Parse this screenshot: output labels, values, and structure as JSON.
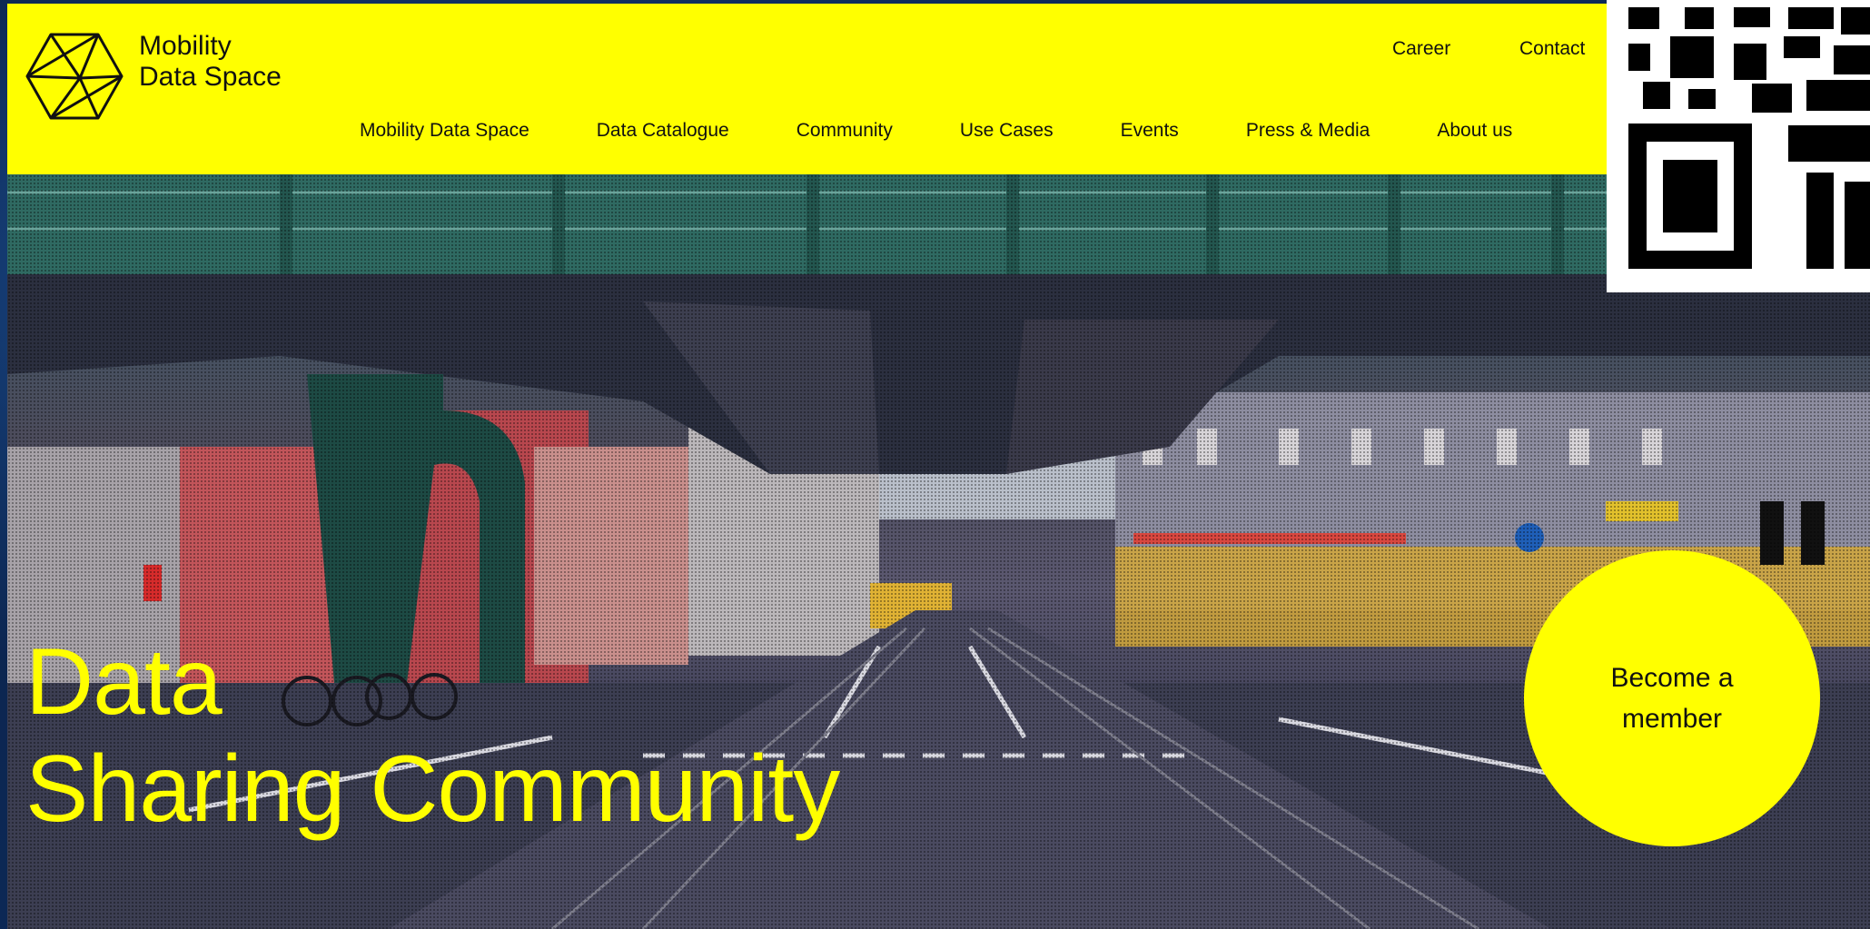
{
  "brand": {
    "line1": "Mobility",
    "line2": "Data Space",
    "logo_icon": "polyhedron-logo-icon",
    "color_yellow": "#ffff00"
  },
  "utility_nav": {
    "career": "Career",
    "contact": "Contact"
  },
  "main_nav": [
    {
      "label": "Mobility Data Space"
    },
    {
      "label": "Data Catalogue"
    },
    {
      "label": "Community"
    },
    {
      "label": "Use Cases"
    },
    {
      "label": "Events"
    },
    {
      "label": "Press & Media"
    },
    {
      "label": "About us"
    }
  ],
  "hero": {
    "title_line1": "Data",
    "title_line2": "Sharing Community",
    "cta_label": "Become a member",
    "image": "berlin-street-under-elevated-railway"
  },
  "overlay": {
    "qr_code": "qr-code-icon"
  }
}
